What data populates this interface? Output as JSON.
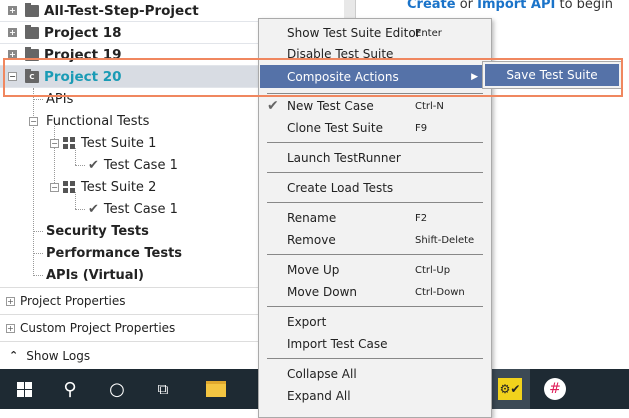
{
  "tree": {
    "projects": [
      {
        "label": "All-Test-Step-Project"
      },
      {
        "label": "Project 18"
      },
      {
        "label": "Project 19"
      },
      {
        "label": "Project 20",
        "selected": true
      }
    ],
    "children": {
      "apis": "APIs",
      "functional_tests": "Functional Tests",
      "test_suite_1": "Test Suite 1",
      "test_case_1a": "Test Case 1",
      "test_suite_2": "Test Suite 2",
      "test_case_1b": "Test Case 1",
      "security_tests": "Security Tests",
      "performance_tests": "Performance Tests",
      "apis_virtual": "APIs (Virtual)"
    },
    "project_icon_letter": "C"
  },
  "properties": {
    "project_properties": "Project Properties",
    "custom_project_properties": "Custom Project Properties"
  },
  "show_logs": "Show Logs",
  "right_panel": {
    "create": "Create",
    "or": " or ",
    "import_api": "Import API",
    "to_begin": " to begin"
  },
  "context_menu": {
    "items": [
      {
        "label": "Show Test Suite Editor",
        "shortcut": "Enter"
      },
      {
        "label": "Disable Test Suite",
        "shortcut": ""
      },
      {
        "label": "Composite Actions",
        "shortcut": ""
      },
      {
        "label": "New Test Case",
        "shortcut": "Ctrl-N"
      },
      {
        "label": "Clone Test Suite",
        "shortcut": "F9"
      },
      {
        "label": "Launch TestRunner",
        "shortcut": ""
      },
      {
        "label": "Create Load Tests",
        "shortcut": ""
      },
      {
        "label": "Rename",
        "shortcut": "F2"
      },
      {
        "label": "Remove",
        "shortcut": "Shift-Delete"
      },
      {
        "label": "Move Up",
        "shortcut": "Ctrl-Up"
      },
      {
        "label": "Move Down",
        "shortcut": "Ctrl-Down"
      },
      {
        "label": "Export",
        "shortcut": ""
      },
      {
        "label": "Import Test Case",
        "shortcut": ""
      },
      {
        "label": "Collapse All",
        "shortcut": ""
      },
      {
        "label": "Expand All",
        "shortcut": ""
      }
    ],
    "submenu": {
      "label": "Save Test Suite"
    }
  },
  "colors": {
    "highlight": "#5572a8",
    "selected_text": "#1a9bb5",
    "annotation": "#f0875f",
    "link": "#1a73c9",
    "taskbar": "#1e2a33"
  }
}
